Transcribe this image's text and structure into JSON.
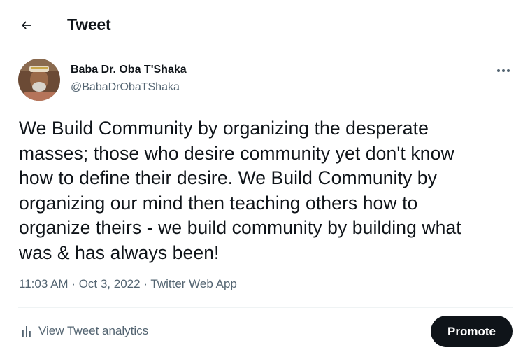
{
  "header": {
    "title": "Tweet",
    "back_icon": "arrow-left-icon"
  },
  "author": {
    "display_name": "Baba Dr. Oba T'Shaka",
    "handle": "@BabaDrObaTShaka",
    "more_icon": "more-horizontal-icon"
  },
  "tweet": {
    "lines": [
      "We Build Community by organizing the desperate",
      "masses; those who desire community yet don't know",
      "how to define their desire. We Build Community by",
      "organizing our mind then teaching others how to",
      "organize theirs - we build community by building what",
      "was & has always been!"
    ]
  },
  "meta": {
    "time": "11:03 AM",
    "separator": " · ",
    "date": "Oct 3, 2022",
    "source": "Twitter Web App"
  },
  "actions": {
    "analytics_label": "View Tweet analytics",
    "analytics_icon": "bar-chart-icon",
    "promote_label": "Promote"
  },
  "colors": {
    "text_primary": "#0f1419",
    "text_secondary": "#536471",
    "divider": "#eff3f4",
    "button_bg": "#0f1419"
  }
}
